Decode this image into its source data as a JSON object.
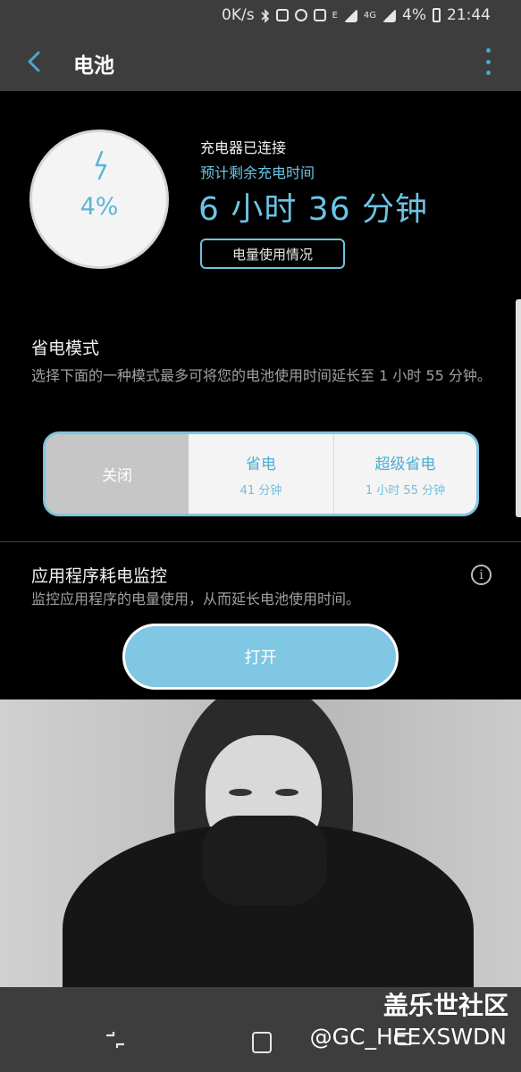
{
  "status_bar": {
    "net_speed": "0K/s",
    "lte_label": "E",
    "net_label": "4G",
    "battery_percent": "4%",
    "time": "21:44"
  },
  "app_bar": {
    "title": "电池"
  },
  "battery": {
    "percent": "4%",
    "charger_status": "充电器已连接",
    "remaining_label": "预计剩余充电时间",
    "remaining_time": "6 小时 36 分钟",
    "usage_button": "电量使用情况"
  },
  "power_saving": {
    "title": "省电模式",
    "description": "选择下面的一种模式最多可将您的电池使用时间延长至 1 小时 55 分钟。",
    "modes": [
      {
        "name": "关闭",
        "sub": ""
      },
      {
        "name": "省电",
        "sub": "41 分钟"
      },
      {
        "name": "超级省电",
        "sub": "1 小时 55 分钟"
      }
    ],
    "selected": "关闭"
  },
  "app_power_monitor": {
    "title": "应用程序耗电监控",
    "description": "监控应用程序的电量使用，从而延长电池使用时间。",
    "button": "打开",
    "info_icon": "info-icon"
  },
  "watermark": {
    "site": "盖乐世社区",
    "handle": "@GC_HEEXSWDN"
  },
  "colors": {
    "accent": "#6cc4e3",
    "bar_bg": "#3d3d3d",
    "background": "#000000"
  }
}
